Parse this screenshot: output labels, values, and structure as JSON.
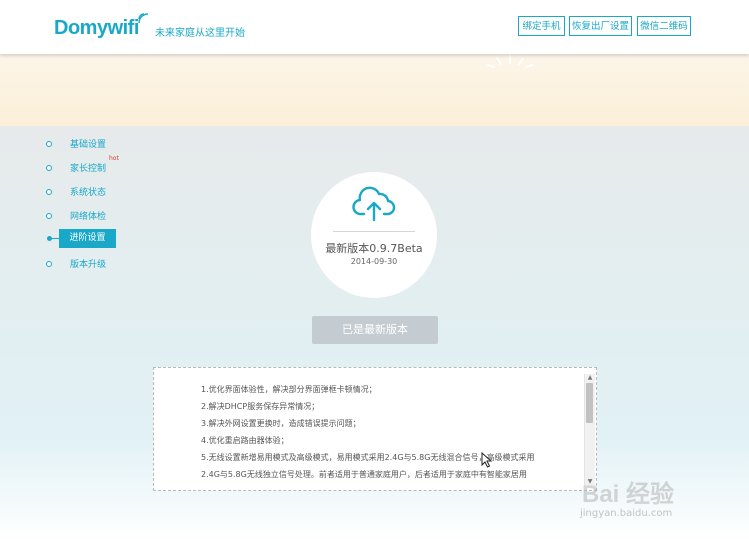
{
  "header": {
    "logo_text": "Domywifi",
    "slogan": "未来家庭从这里开始",
    "buttons": [
      {
        "label": "绑定手机"
      },
      {
        "label": "恢复出厂设置"
      },
      {
        "label": "微信二维码"
      }
    ]
  },
  "sidebar": {
    "items": [
      {
        "label": "基础设置"
      },
      {
        "label": "家长控制",
        "badge": "hot"
      },
      {
        "label": "系统状态"
      },
      {
        "label": "网络体检"
      },
      {
        "label": "进阶设置",
        "active": true
      },
      {
        "label": "版本升级"
      }
    ]
  },
  "update": {
    "version_text": "最新版本0.9.7Beta",
    "date": "2014-09-30",
    "status_label": "已是最新版本"
  },
  "release_notes": [
    "1.优化界面体验性，解决部分界面弹框卡顿情况；",
    "2.解决DHCP服务保存异常情况；",
    "3.解决外网设置更换时，造成错误提示问题；",
    "4.优化重启路由器体验；",
    "5.无线设置新增易用模式及高级模式，易用模式采用2.4G与5.8G无线混合信号，高级模式采用",
    "2.4G与5.8G无线独立信号处理。前者适用于普通家庭用户，后者适用于家庭中有智能家居用"
  ],
  "watermark": {
    "text": "Bai 经验",
    "url": "jingyan.baidu.com"
  },
  "colors": {
    "accent": "#1aa8c8",
    "hot": "#e23a2a",
    "button_disabled": "#c4ccd1"
  }
}
